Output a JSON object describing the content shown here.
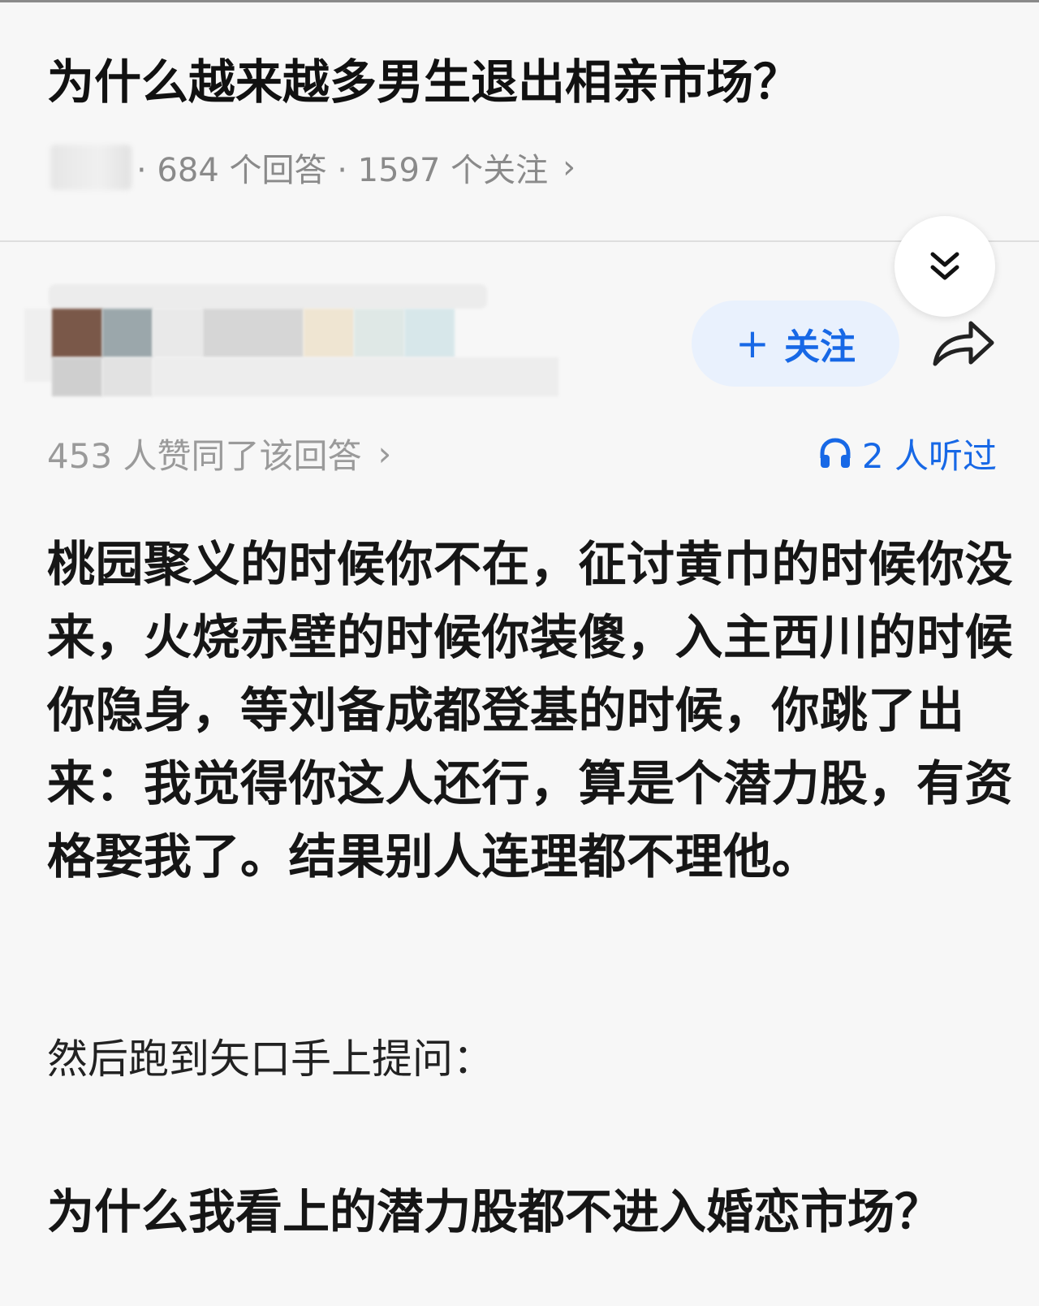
{
  "question": {
    "title": "为什么越来越多男生退出相亲市场？",
    "meta_text": "· 684 个回答 · 1597 个关注",
    "meta_chevron": "›"
  },
  "author": {
    "follow_label": "关注",
    "follow_plus": "+"
  },
  "stats": {
    "likes_text": "453 人赞同了该回答",
    "likes_chevron": "›",
    "listened_text": "2 人听过",
    "accent_color": "#1768e6"
  },
  "answer": {
    "body": "桃园聚义的时候你不在，征讨黄巾的时候你没来，火烧赤壁的时候你装傻，入主西川的时候你隐身，等刘备成都登基的时候，你跳了出来：我觉得你这人还行，算是个潜力股，有资格娶我了。结果别人连理都不理他。",
    "followup": "然后跑到矢口手上提问：",
    "quoted_question": "为什么我看上的潜力股都不进入婚恋市场？"
  },
  "icons": {
    "collapse": "double-chevron-down-icon",
    "share": "share-arrow-icon",
    "listen": "headphones-icon"
  }
}
